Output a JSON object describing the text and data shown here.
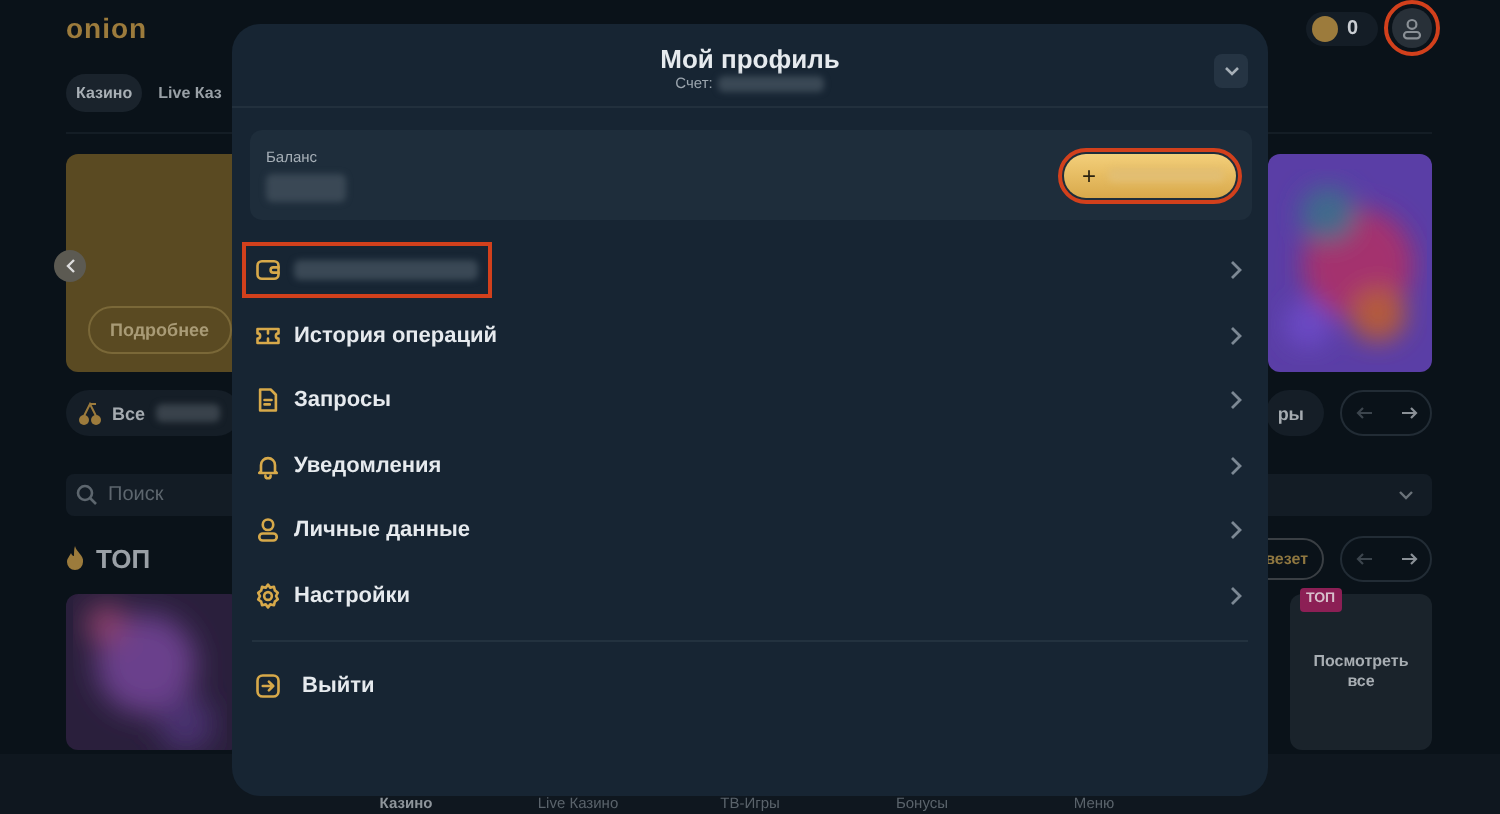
{
  "header": {
    "logo": "onion",
    "coin_balance": "0",
    "profile_button": {
      "highlighted": true
    }
  },
  "nav_tabs": [
    {
      "label": "Казино",
      "selected": true
    },
    {
      "label": "Live Каз",
      "selected": false
    }
  ],
  "banner": {
    "button": "Подробнее"
  },
  "category_chips": [
    {
      "label": "Все",
      "redacted": true
    },
    {
      "label": "ры",
      "redacted": false
    }
  ],
  "search": {
    "placeholder": "Поиск"
  },
  "top_section": {
    "title": "ТОП",
    "filter_chip": "везет",
    "badge": "ТОП",
    "view_all": "Посмотреть все"
  },
  "bottom_nav": [
    {
      "label": "Казино",
      "selected": true
    },
    {
      "label": "Live Казино",
      "selected": false
    },
    {
      "label": "ТВ-Игры",
      "selected": false
    },
    {
      "label": "Бонусы",
      "selected": false
    },
    {
      "label": "Меню",
      "selected": false
    }
  ],
  "profile_modal": {
    "title": "Мой профиль",
    "account_label": "Счет:",
    "balance_label": "Баланс",
    "deposit_button": {
      "symbol": "+",
      "highlighted": true
    },
    "menu": [
      {
        "kind": "wallet",
        "redacted": true,
        "highlighted": true
      },
      {
        "kind": "ticket",
        "label": "История операций",
        "redacted": false,
        "highlighted": false
      },
      {
        "kind": "document",
        "label": "Запросы",
        "redacted": false,
        "highlighted": false
      },
      {
        "kind": "bell",
        "label": "Уведомления",
        "redacted": false,
        "highlighted": false
      },
      {
        "kind": "person",
        "label": "Личные данные",
        "redacted": false,
        "highlighted": false
      },
      {
        "kind": "gear",
        "label": "Настройки",
        "redacted": false,
        "highlighted": false
      }
    ],
    "logout": {
      "kind": "logout",
      "label": "Выйти"
    }
  }
}
